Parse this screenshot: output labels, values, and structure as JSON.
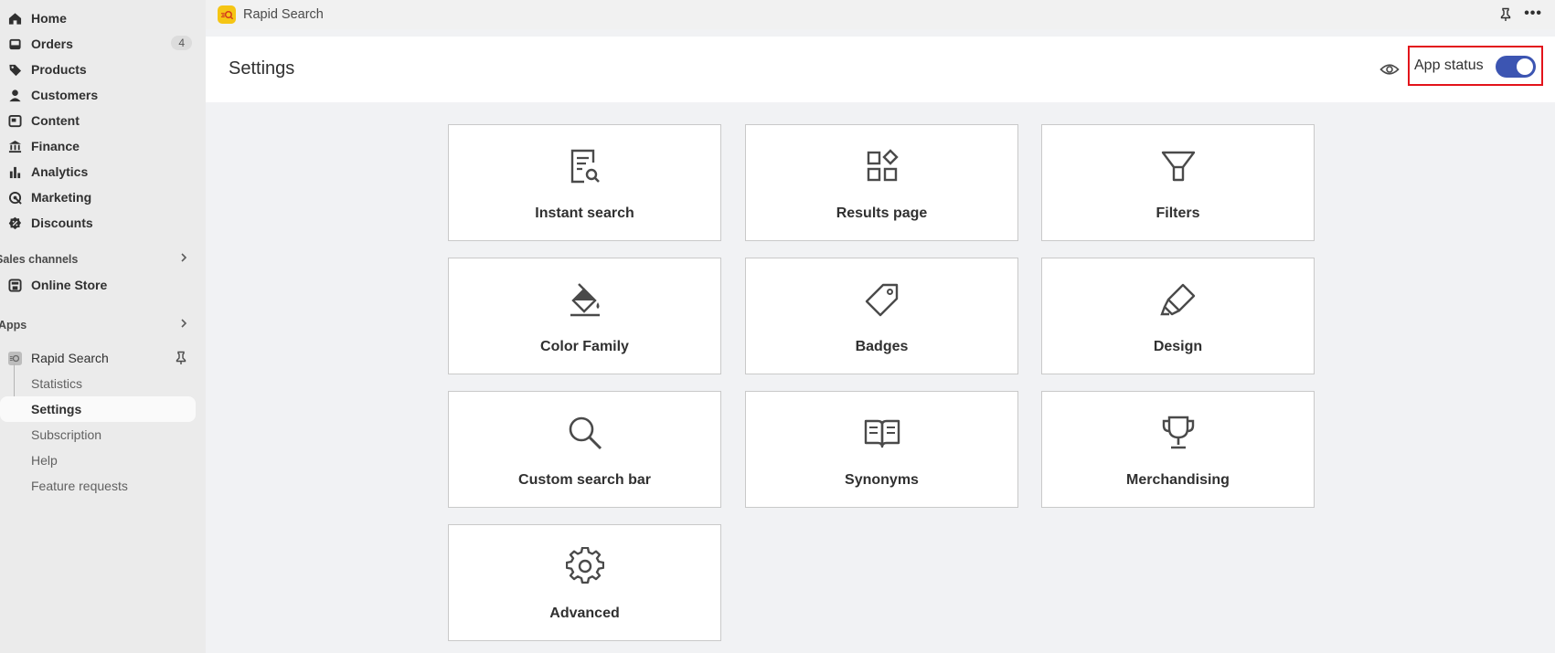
{
  "sidebar": {
    "nav": [
      {
        "label": "Home",
        "icon": "home-icon"
      },
      {
        "label": "Orders",
        "icon": "orders-icon",
        "badge": "4"
      },
      {
        "label": "Products",
        "icon": "tag-icon"
      },
      {
        "label": "Customers",
        "icon": "person-icon"
      },
      {
        "label": "Content",
        "icon": "content-icon"
      },
      {
        "label": "Finance",
        "icon": "bank-icon"
      },
      {
        "label": "Analytics",
        "icon": "bar-chart-icon"
      },
      {
        "label": "Marketing",
        "icon": "target-icon"
      },
      {
        "label": "Discounts",
        "icon": "discount-icon"
      }
    ],
    "sales_channels": "Sales channels",
    "online_store": "Online Store",
    "apps": "Apps",
    "app_name": "Rapid Search",
    "app_subitems": [
      "Statistics",
      "Settings",
      "Subscription",
      "Help",
      "Feature requests"
    ]
  },
  "topbar": {
    "title": "Rapid Search"
  },
  "header": {
    "title": "Settings",
    "status_label": "App status",
    "status_on": true,
    "toggle_color": "#3c55b2"
  },
  "cards": [
    {
      "label": "Instant search",
      "icon": "document-search-icon"
    },
    {
      "label": "Results page",
      "icon": "grid-shapes-icon"
    },
    {
      "label": "Filters",
      "icon": "filter-funnel-icon"
    },
    {
      "label": "Color Family",
      "icon": "paint-bucket-icon"
    },
    {
      "label": "Badges",
      "icon": "tag-outline-icon"
    },
    {
      "label": "Design",
      "icon": "highlighter-icon"
    },
    {
      "label": "Custom search bar",
      "icon": "magnifier-icon"
    },
    {
      "label": "Synonyms",
      "icon": "open-book-icon"
    },
    {
      "label": "Merchandising",
      "icon": "trophy-icon"
    },
    {
      "label": "Advanced",
      "icon": "gear-icon"
    }
  ]
}
